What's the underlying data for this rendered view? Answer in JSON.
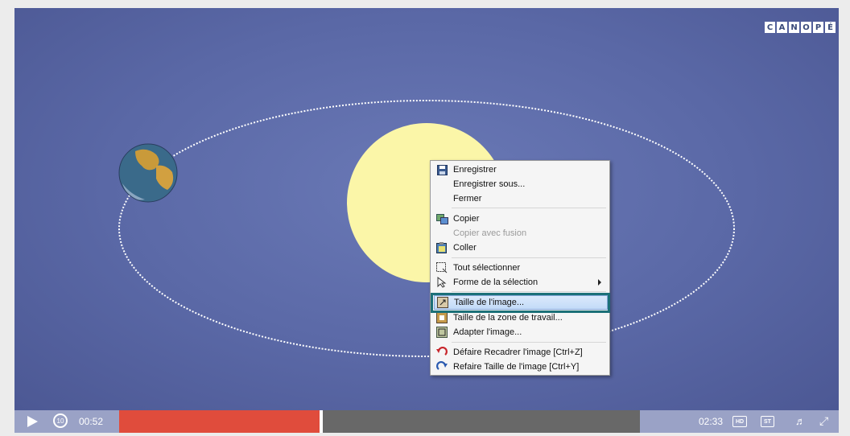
{
  "logo": {
    "letters": [
      "C",
      "A",
      "N",
      "O",
      "P",
      "É"
    ]
  },
  "controls": {
    "current_time": "00:52",
    "total_time": "02:33",
    "replay_label": "10",
    "progress": 0.385,
    "hd_label": "HD",
    "st_label": "ST",
    "volume_icon": "speaker-icon",
    "fullscreen_icon": "expand-icon"
  },
  "menu": {
    "items": [
      {
        "label": "Enregistrer",
        "icon": "save-icon",
        "enabled": true
      },
      {
        "label": "Enregistrer sous...",
        "icon": "",
        "enabled": true
      },
      {
        "label": "Fermer",
        "icon": "",
        "enabled": true
      },
      {
        "label": "Copier",
        "icon": "copy-icon",
        "enabled": true
      },
      {
        "label": "Copier avec fusion",
        "icon": "",
        "enabled": false
      },
      {
        "label": "Coller",
        "icon": "paste-icon",
        "enabled": true
      },
      {
        "label": "Tout sélectionner",
        "icon": "select-all-icon",
        "enabled": true
      },
      {
        "label": "Forme de la sélection",
        "icon": "pointer-icon",
        "enabled": true,
        "submenu": true
      },
      {
        "label": "Taille de l'image...",
        "icon": "resize-image-icon",
        "enabled": true,
        "highlighted": true
      },
      {
        "label": "Taille de la zone de travail...",
        "icon": "canvas-size-icon",
        "enabled": true
      },
      {
        "label": "Adapter l'image...",
        "icon": "fit-image-icon",
        "enabled": true
      },
      {
        "label": "Défaire Recadrer l'image [Ctrl+Z]",
        "icon": "undo-icon",
        "enabled": true
      },
      {
        "label": "Refaire Taille de l'image [Ctrl+Y]",
        "icon": "redo-icon",
        "enabled": true
      }
    ]
  },
  "colors": {
    "sun": "#fbf6a8",
    "background": "#5a68a6",
    "progress_fill": "#e04c3c",
    "highlight_frame": "#1c7078"
  }
}
